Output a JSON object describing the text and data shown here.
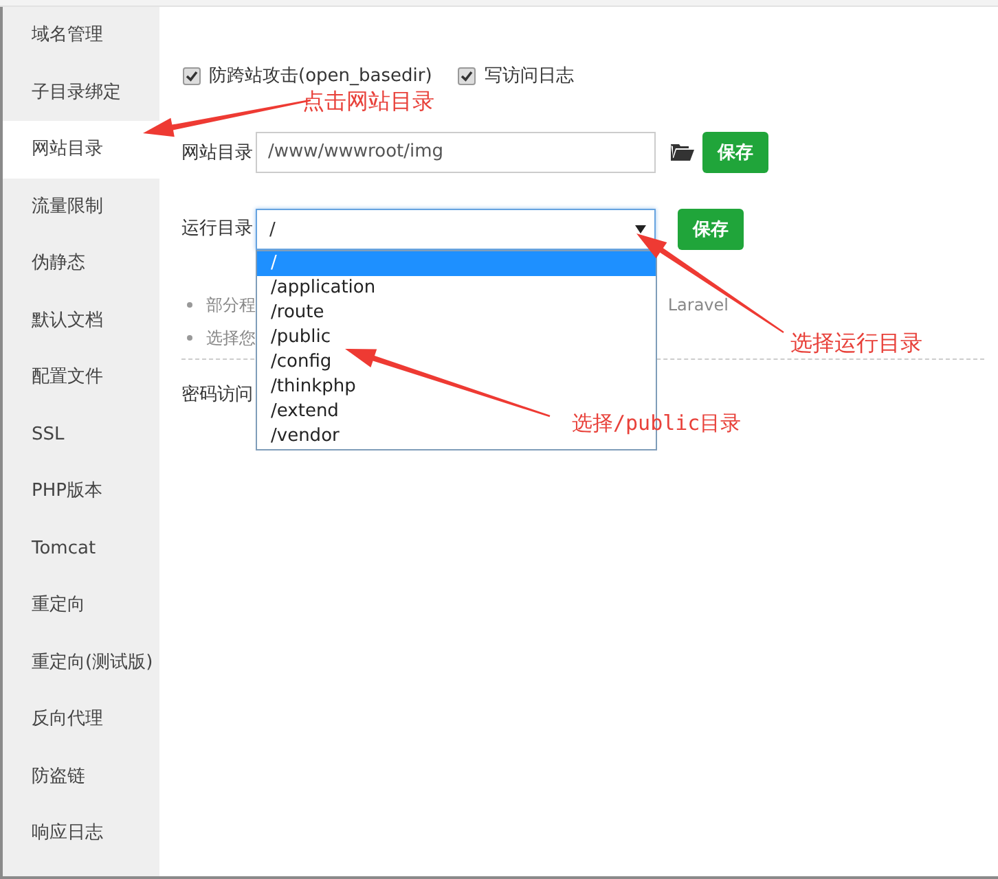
{
  "sidebar": {
    "items": [
      {
        "label": "域名管理",
        "selected": false
      },
      {
        "label": "子目录绑定",
        "selected": false
      },
      {
        "label": "网站目录",
        "selected": true
      },
      {
        "label": "流量限制",
        "selected": false
      },
      {
        "label": "伪静态",
        "selected": false
      },
      {
        "label": "默认文档",
        "selected": false
      },
      {
        "label": "配置文件",
        "selected": false
      },
      {
        "label": "SSL",
        "selected": false
      },
      {
        "label": "PHP版本",
        "selected": false
      },
      {
        "label": "Tomcat",
        "selected": false
      },
      {
        "label": "重定向",
        "selected": false
      },
      {
        "label": "重定向(测试版)",
        "selected": false
      },
      {
        "label": "反向代理",
        "selected": false
      },
      {
        "label": "防盗链",
        "selected": false
      },
      {
        "label": "响应日志",
        "selected": false
      }
    ]
  },
  "checkboxes": [
    {
      "label": "防跨站攻击(open_basedir)",
      "checked": true
    },
    {
      "label": "写访问日志",
      "checked": true
    }
  ],
  "site_dir": {
    "label": "网站目录",
    "value": "/www/wwwroot/img",
    "save_button": "保存"
  },
  "run_dir": {
    "label": "运行目录",
    "value": "/",
    "save_button": "保存",
    "dropdown": {
      "options": [
        {
          "label": "/",
          "selected": true
        },
        {
          "label": "/application",
          "selected": false
        },
        {
          "label": "/route",
          "selected": false
        },
        {
          "label": "/public",
          "selected": false
        },
        {
          "label": "/config",
          "selected": false
        },
        {
          "label": "/thinkphp",
          "selected": false
        },
        {
          "label": "/extend",
          "selected": false
        },
        {
          "label": "/vendor",
          "selected": false
        }
      ]
    }
  },
  "notes": [
    {
      "text": "部分程",
      "trailing": "Laravel"
    },
    {
      "text": "选择您"
    }
  ],
  "password": {
    "label": "密码访问"
  },
  "annotations": [
    {
      "text": "点击网站目录"
    },
    {
      "text": "选择运行目录"
    },
    {
      "text": "选择/public目录"
    }
  ]
}
